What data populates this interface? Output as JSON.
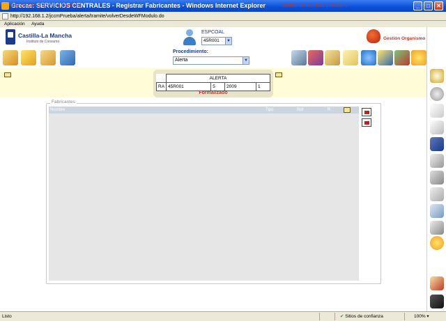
{
  "window": {
    "title": "Grecae: SERVICIOS CENTRALES - Registrar Fabricantes - Windows Internet Explorer",
    "url": "http://192.168.1.2/jccmPrueba/alerta/tramite/volverDesdeWFModulo.do",
    "minimize": "_",
    "maximize": "□",
    "close": "✕"
  },
  "menu": {
    "items": [
      "Aplicación",
      "Ayuda"
    ]
  },
  "header": {
    "logo_name": "Castilla-La Mancha",
    "logo_sub": "Instituto de Consumo",
    "user_label": "ESPCOAL",
    "user_code": "45R001",
    "org_label": "Gestión Organismo"
  },
  "procedure": {
    "label": "Procedimiento:",
    "value": "Alerta"
  },
  "alert": {
    "left_link": "CR-45R001/17/2009-1 Contiene",
    "right_link": "Motiva CR-45R001/17/2009-1",
    "header": "ALERTA",
    "cells": [
      "RA",
      "45R001",
      "5",
      "2009",
      "1"
    ],
    "status": "Formalizado"
  },
  "fabricantes": {
    "legend": "Fabricantes",
    "columns": [
      "Nombre",
      "Tipo",
      "Rol",
      "R."
    ]
  },
  "status": {
    "text": "Listo",
    "trust": "Sitios de confianza",
    "zoom": "100%"
  },
  "icons": {
    "toolbar_left": [
      "edit-icon",
      "folder-star-icon",
      "folder-icon",
      "export-icon"
    ],
    "toolbar_right": [
      "laptop-icon",
      "books-icon",
      "documents-icon",
      "envelope-icon",
      "globe-icon",
      "search-docs-icon",
      "chart-icon",
      "sun-icon",
      "book-icon"
    ],
    "right_strip": [
      "zoom-icon",
      "back-icon",
      "page-icon",
      "copy-icon",
      "save-icon",
      "scissors-icon",
      "fax-icon",
      "clip-icon",
      "bottle-icon",
      "printer-icon",
      "star-gear-icon",
      "cancel-icon",
      "car-icon"
    ]
  },
  "colors": {
    "accent_red": "#c0382b",
    "brand_blue": "#1a3b8c",
    "info_bg": "#fffcd8"
  }
}
